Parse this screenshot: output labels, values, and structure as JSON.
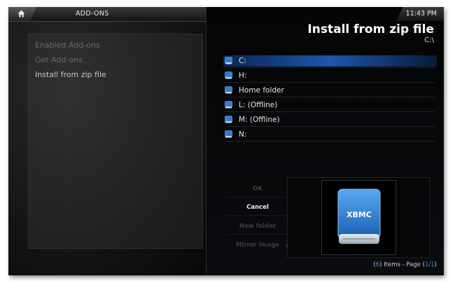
{
  "header": {
    "section_title": "ADD-ONS",
    "clock": "11:43 PM",
    "home_icon": "home-icon"
  },
  "menu": {
    "items": [
      {
        "label": "Enabled Add-ons",
        "active": false
      },
      {
        "label": "Get Add-ons",
        "active": false
      },
      {
        "label": "Install from zip file",
        "active": true
      }
    ]
  },
  "main": {
    "title": "Install from zip file",
    "path": "C:\\",
    "files": [
      {
        "label": "C:",
        "selected": true,
        "icon": "drive-icon"
      },
      {
        "label": "H:",
        "selected": false,
        "icon": "drive-icon"
      },
      {
        "label": "Home folder",
        "selected": false,
        "icon": "drive-icon"
      },
      {
        "label": "L: (Offline)",
        "selected": false,
        "icon": "drive-icon"
      },
      {
        "label": "M: (Offline)",
        "selected": false,
        "icon": "drive-icon"
      },
      {
        "label": "N:",
        "selected": false,
        "icon": "drive-icon"
      }
    ]
  },
  "buttons": {
    "ok": "OK",
    "cancel": "Cancel",
    "new_folder": "New folder",
    "mirror_image": "Mirror image"
  },
  "preview": {
    "brand": "XBMC",
    "accent": "#2c7fd6"
  },
  "status": {
    "count": "6",
    "items_text": " Items - Page ",
    "page": "1/1"
  },
  "colors": {
    "highlight": "#1e5ab4",
    "link": "#3d8be0"
  }
}
